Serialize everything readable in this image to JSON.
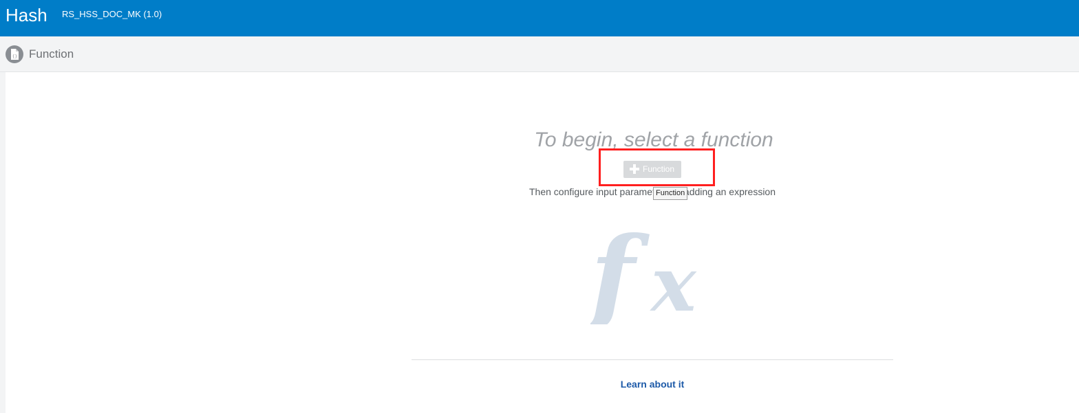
{
  "header": {
    "title": "Hash",
    "subtitle": "RS_HSS_DOC_MK (1.0)",
    "bar_color": "#007dc8"
  },
  "section": {
    "icon": "document-function-icon",
    "title": "Function"
  },
  "empty_state": {
    "headline": "To begin, select a function",
    "add_button": {
      "icon": "plus-icon",
      "label": "Function"
    },
    "instruction": "Then configure input parameters by adding an expression",
    "tooltip": "Function",
    "graphic": "fx-icon",
    "link": "Learn about it"
  },
  "colors": {
    "highlight": "#ff1f1f",
    "link": "#1d5aa8"
  }
}
